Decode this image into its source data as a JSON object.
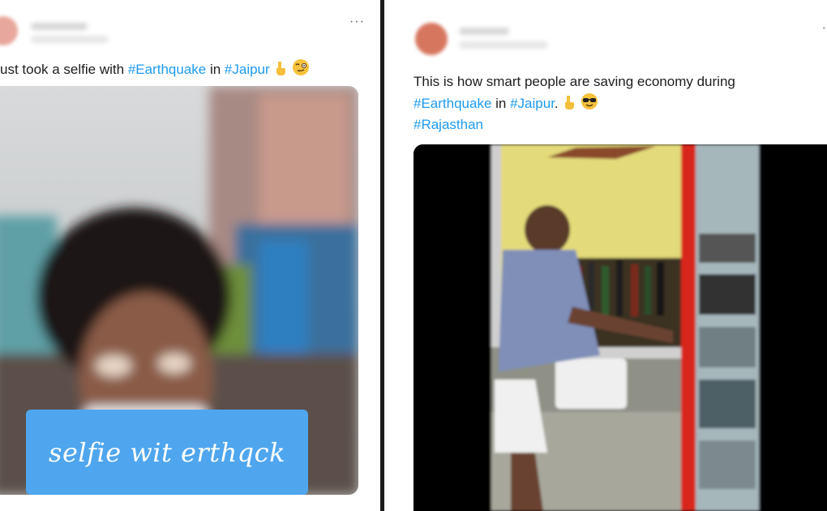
{
  "left_tweet": {
    "more_label": "···",
    "text_plain_1": "ust took a selfie with ",
    "hashtag_1": "#Earthquake",
    "text_plain_2": " in ",
    "hashtag_2": "#Jaipur",
    "emoji_icons": [
      "pointing-down-icon",
      "smirk-face-icon"
    ],
    "media": {
      "caption": "selfie wit erthqck",
      "caption_bg": "#4fa6ee"
    }
  },
  "right_tweet": {
    "line1": "This is how smart people are saving economy during",
    "hashtag_1": "#Earthquake",
    "text_plain_1": " in ",
    "hashtag_2": "#Jaipur",
    "text_plain_2": ".",
    "hashtag_3": "#Rajasthan",
    "emoji_icons": [
      "pointing-down-icon",
      "sunglasses-face-icon"
    ],
    "more_label": "·"
  },
  "colors": {
    "hashtag": "#1d9bf0",
    "text": "#1d1d1d",
    "divider": "#1b1b1b"
  }
}
